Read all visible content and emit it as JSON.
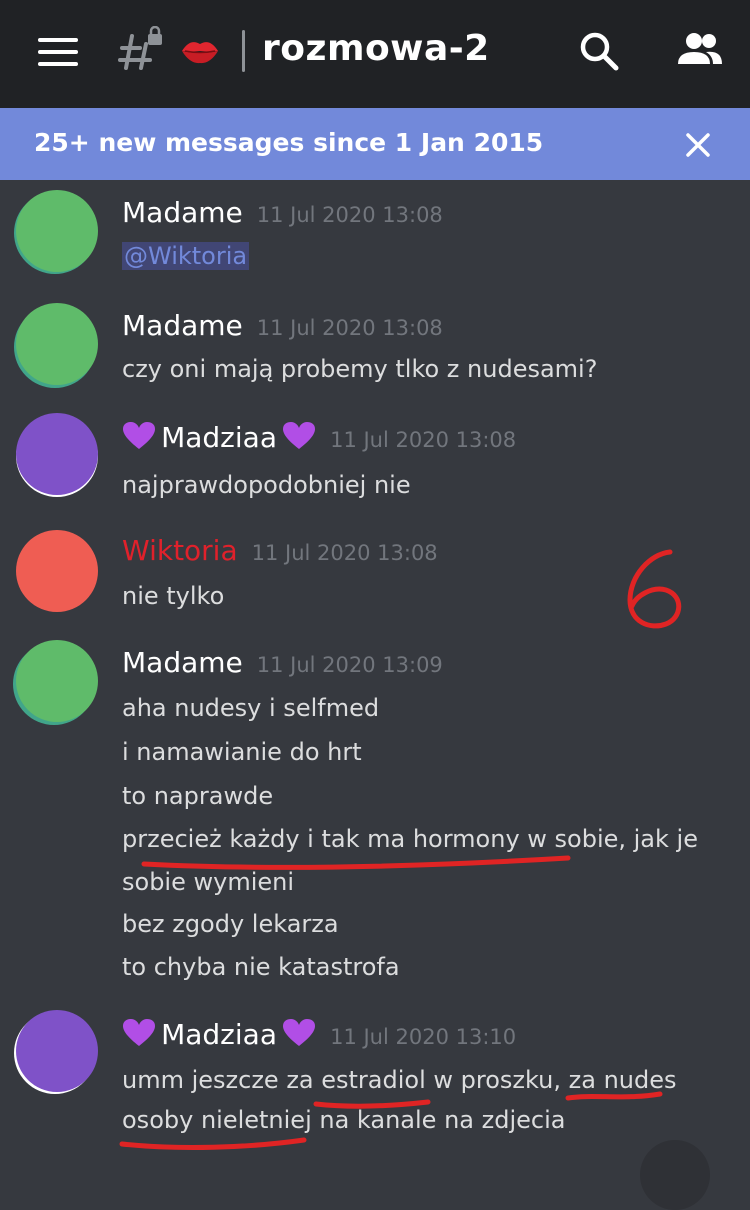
{
  "channel": {
    "name": "rozmowa-2",
    "emoji": "kiss-lips-emoji"
  },
  "banner": {
    "text": "25+ new messages since 1 Jan 2015"
  },
  "colors": {
    "background": "#36393f",
    "topbar": "#202225",
    "banner": "#7289da",
    "green_avatar": "#5fbb6a",
    "purple_avatar": "#7f52c8",
    "red_avatar": "#ef5d53",
    "wiktoria_name": "#e0212b",
    "annotation_red": "#e02424"
  },
  "messages": [
    {
      "author": "Madame",
      "timestamp": "11 Jul 2020 13:08",
      "lines": [
        "@Wiktoria"
      ]
    },
    {
      "author": "Madame",
      "timestamp": "11 Jul 2020 13:08",
      "lines": [
        "czy oni mają probemy tlko z nudesami?"
      ]
    },
    {
      "author": "Madziaa",
      "timestamp": "11 Jul 2020 13:08",
      "lines": [
        "najprawdopodobniej nie"
      ]
    },
    {
      "author": "Wiktoria",
      "timestamp": "11 Jul 2020 13:08",
      "lines": [
        "nie tylko"
      ]
    },
    {
      "author": "Madame",
      "timestamp": "11 Jul 2020 13:09",
      "lines": [
        "aha nudesy i selfmed",
        "i namawianie do hrt",
        "to naprawde",
        "przecież każdy i tak ma hormony w sobie, jak je",
        "sobie wymieni",
        "bez zgody lekarza",
        "to chyba nie katastrofa"
      ]
    },
    {
      "author": "Madziaa",
      "timestamp": "11 Jul 2020 13:10",
      "lines": [
        "umm jeszcze za estradiol w proszku, za nudes",
        "osoby nieletniej na kanale na zdjecia"
      ]
    }
  ],
  "annotation": {
    "number": "6"
  }
}
